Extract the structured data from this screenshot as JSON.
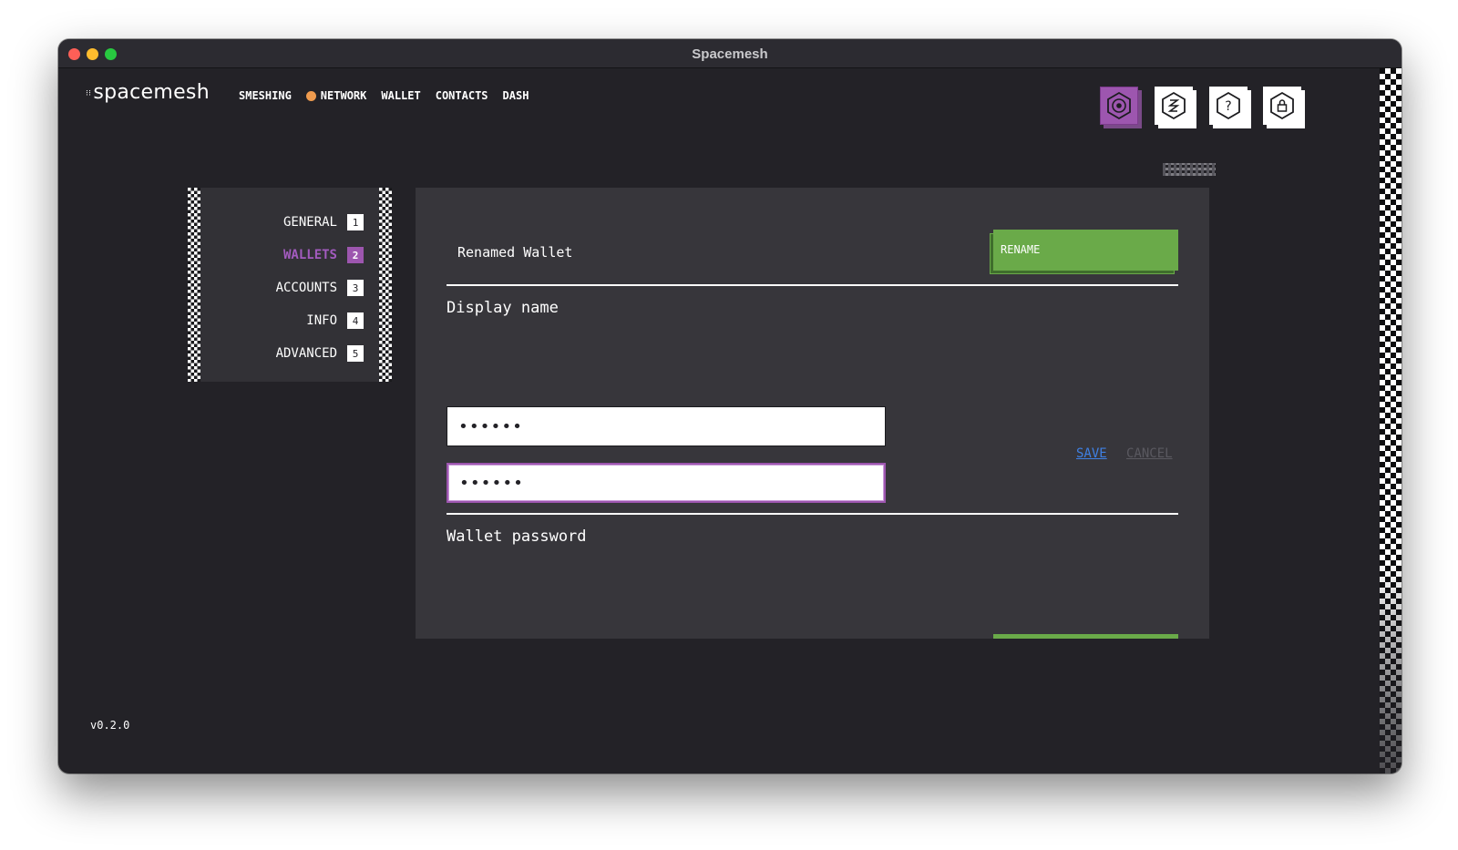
{
  "window": {
    "title": "Spacemesh"
  },
  "brand": {
    "logo_text": "spacemesh",
    "logo_mark": "⁝⁝"
  },
  "nav": {
    "items": [
      {
        "label": "SMESHING"
      },
      {
        "label": "NETWORK",
        "status_color": "#ef9b4e"
      },
      {
        "label": "WALLET"
      },
      {
        "label": "CONTACTS"
      },
      {
        "label": "DASH"
      }
    ]
  },
  "toolbar_icons": [
    {
      "name": "settings-icon",
      "active": true
    },
    {
      "name": "smesh-coin-icon",
      "active": false
    },
    {
      "name": "help-icon",
      "active": false,
      "glyph": "?"
    },
    {
      "name": "lock-icon",
      "active": false
    }
  ],
  "settings_menu": {
    "items": [
      {
        "label": "GENERAL",
        "num": "1",
        "active": false
      },
      {
        "label": "WALLETS",
        "num": "2",
        "active": true
      },
      {
        "label": "ACCOUNTS",
        "num": "3",
        "active": false
      },
      {
        "label": "INFO",
        "num": "4",
        "active": false
      },
      {
        "label": "ADVANCED",
        "num": "5",
        "active": false
      }
    ]
  },
  "wallet_section": {
    "wallet_name": "Renamed Wallet",
    "rename_label": "RENAME",
    "display_name_label": "Display name",
    "password_value": "••••••",
    "confirm_password_value": "••••••",
    "save_label": "SAVE",
    "cancel_label": "CANCEL",
    "wallet_password_label": "Wallet password"
  },
  "footer": {
    "version": "v0.2.0"
  },
  "colors": {
    "background": "#232227",
    "panel": "#37363b",
    "accent_purple": "#9d56af",
    "accent_green": "#6aaa49",
    "link_blue": "#3f80e3"
  }
}
